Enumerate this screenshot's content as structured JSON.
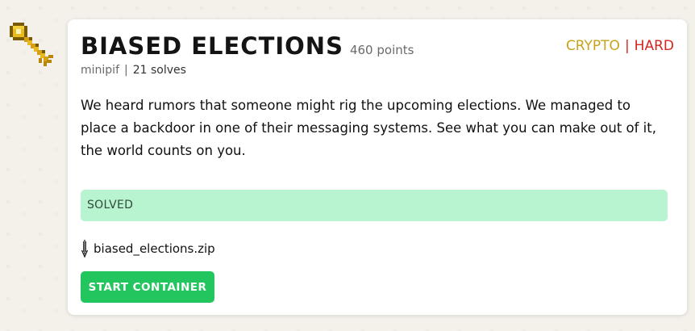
{
  "challenge": {
    "title": "BIASED ELECTIONS",
    "points": "460 points",
    "category": "CRYPTO",
    "category_separator": "|",
    "difficulty": "HARD",
    "author": "minipif",
    "meta_separator": "|",
    "solves": "21 solves",
    "description": "We heard rumors that someone might rig the upcoming elections. We managed to place a backdoor in one of their messaging systems. See what you can make out of it, the world counts on you.",
    "status": "SOLVED",
    "file_name": "biased_elections.zip",
    "start_button_label": "START CONTAINER"
  },
  "icons": {
    "challenge_icon": "key-icon",
    "file_icon": "download-icon"
  },
  "colors": {
    "category": "#c9a21b",
    "difficulty": "#d3261e",
    "solved_banner": "#b9f4d0",
    "start_button": "#23c55e"
  }
}
